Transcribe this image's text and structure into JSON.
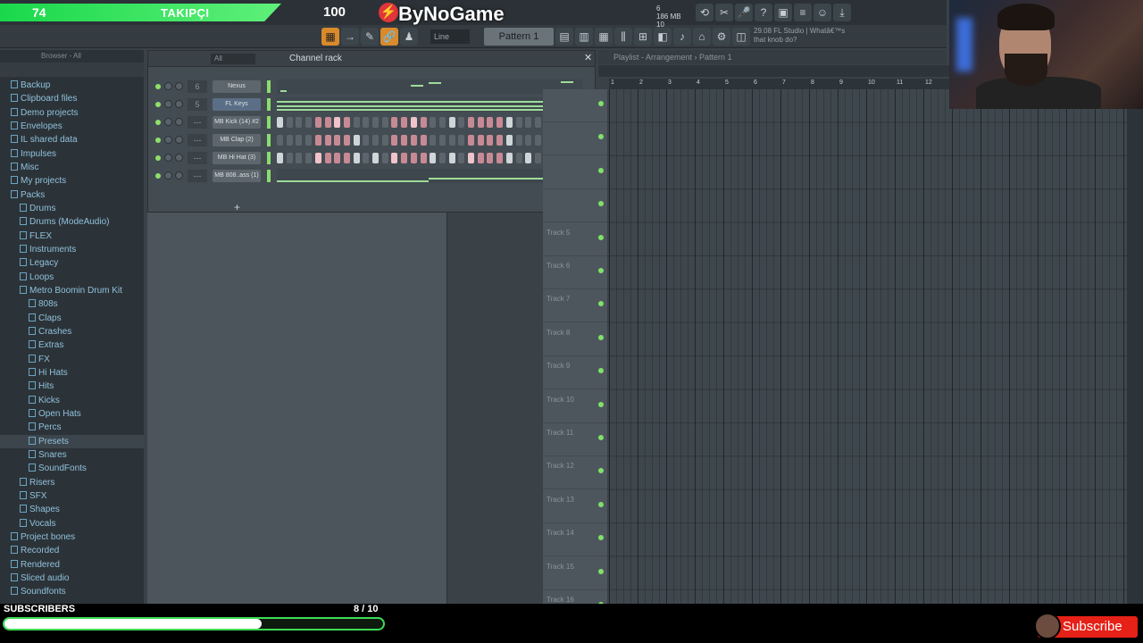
{
  "overlay": {
    "follower_count": "74",
    "follower_label": "TAKIPÇI",
    "brand": "ByNoGame",
    "subscribers_label": "SUBSCRIBERS",
    "subscribers_progress": "8 / 10",
    "subscribers_progress_fraction": 0.8,
    "subscribe_button": "Subscribe"
  },
  "toolbar": {
    "tempo": "100",
    "cpu_value": "6",
    "memory": "186 MB",
    "voices": "10",
    "snap": "Line",
    "pattern": "Pattern 1",
    "hint_line1": "29.08 FL Studio | Whatâ€™s",
    "hint_line2": "that knob do?"
  },
  "browser": {
    "header": "Browser - All",
    "items": [
      {
        "label": "Backup",
        "level": 0
      },
      {
        "label": "Clipboard files",
        "level": 0
      },
      {
        "label": "Demo projects",
        "level": 0
      },
      {
        "label": "Envelopes",
        "level": 0
      },
      {
        "label": "IL shared data",
        "level": 0
      },
      {
        "label": "Impulses",
        "level": 0
      },
      {
        "label": "Misc",
        "level": 0
      },
      {
        "label": "My projects",
        "level": 0
      },
      {
        "label": "Packs",
        "level": 0
      },
      {
        "label": "Drums",
        "level": 1
      },
      {
        "label": "Drums (ModeAudio)",
        "level": 1
      },
      {
        "label": "FLEX",
        "level": 1
      },
      {
        "label": "Instruments",
        "level": 1
      },
      {
        "label": "Legacy",
        "level": 1
      },
      {
        "label": "Loops",
        "level": 1
      },
      {
        "label": "Metro Boomin Drum Kit",
        "level": 1
      },
      {
        "label": "808s",
        "level": 2
      },
      {
        "label": "Claps",
        "level": 2
      },
      {
        "label": "Crashes",
        "level": 2
      },
      {
        "label": "Extras",
        "level": 2
      },
      {
        "label": "FX",
        "level": 2
      },
      {
        "label": "Hi Hats",
        "level": 2
      },
      {
        "label": "Hits",
        "level": 2
      },
      {
        "label": "Kicks",
        "level": 2
      },
      {
        "label": "Open Hats",
        "level": 2
      },
      {
        "label": "Percs",
        "level": 2
      },
      {
        "label": "Presets",
        "level": 2
      },
      {
        "label": "Snares",
        "level": 2
      },
      {
        "label": "SoundFonts",
        "level": 2
      },
      {
        "label": "Risers",
        "level": 1
      },
      {
        "label": "SFX",
        "level": 1
      },
      {
        "label": "Shapes",
        "level": 1
      },
      {
        "label": "Vocals",
        "level": 1
      },
      {
        "label": "Project bones",
        "level": 0
      },
      {
        "label": "Recorded",
        "level": 0
      },
      {
        "label": "Rendered",
        "level": 0
      },
      {
        "label": "Sliced audio",
        "level": 0
      },
      {
        "label": "Soundfonts",
        "level": 0
      }
    ],
    "selected": "Presets"
  },
  "channel_rack": {
    "title": "Channel rack",
    "filter": "All",
    "channels": [
      {
        "number": "6",
        "name": "Nexus",
        "type": "piano"
      },
      {
        "number": "5",
        "name": "FL Keys",
        "type": "piano",
        "selected": true
      },
      {
        "number": "---",
        "name": "MB Kick (14) #2",
        "type": "steps",
        "on": [
          0,
          6,
          14,
          18,
          24,
          30
        ]
      },
      {
        "number": "---",
        "name": "MB Clap (2)",
        "type": "steps",
        "on": [
          8,
          24
        ]
      },
      {
        "number": "---",
        "name": "MB Hi Hat (3)",
        "type": "steps",
        "on": [
          0,
          4,
          8,
          10,
          12,
          16,
          18,
          20,
          24,
          26,
          28,
          30
        ]
      },
      {
        "number": "---",
        "name": "MB 808..ass (1)",
        "type": "piano"
      }
    ]
  },
  "playlist": {
    "title": "Playlist - Arrangement",
    "pattern": "Pattern 1",
    "bars": [
      "1",
      "2",
      "3",
      "4",
      "5",
      "6",
      "7",
      "8",
      "9",
      "10",
      "11",
      "12"
    ],
    "tracks": [
      "Track 5",
      "Track 6",
      "Track 7",
      "Track 8",
      "Track 9",
      "Track 10",
      "Track 11",
      "Track 12",
      "Track 13",
      "Track 14",
      "Track 15",
      "Track 16"
    ]
  }
}
